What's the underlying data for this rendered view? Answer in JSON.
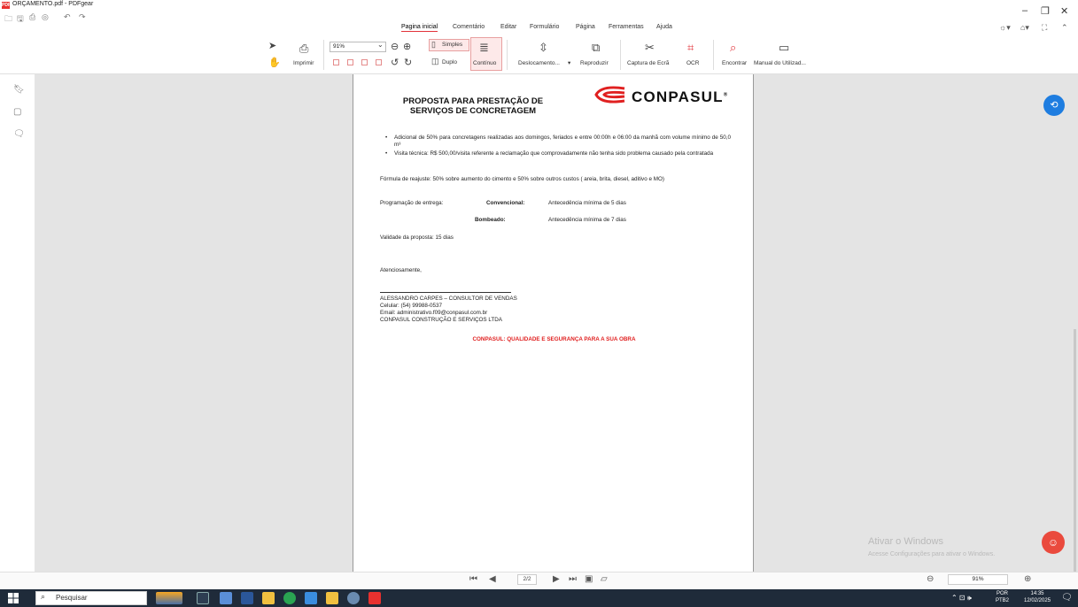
{
  "window": {
    "title": "ORÇAMENTO.pdf - PDFgear",
    "app_badge": "PDF"
  },
  "quick_access": [
    "open-icon",
    "save-icon",
    "print-icon",
    "share-icon",
    "undo-icon",
    "redo-icon"
  ],
  "menu": {
    "items": [
      "Pagina inicial",
      "Comentário",
      "Editar",
      "Formulário",
      "Página",
      "Ferramentas",
      "Ajuda"
    ],
    "active": "Pagina inicial"
  },
  "ribbon": {
    "print_label": "Imprimir",
    "zoom_value": "91%",
    "simple_label": "Simples",
    "double_label": "Duplo",
    "continuous_label": "Contínuo",
    "scroll_label": "Deslocamento...",
    "play_label": "Reproduzir",
    "capture_label": "Captura de Ecrã",
    "ocr_label": "OCR",
    "find_label": "Encontrar",
    "manual_label": "Manual do Utilizad..."
  },
  "document": {
    "title_line1": "PROPOSTA PARA PRESTAÇÃO DE",
    "title_line2": "SERVIÇOS DE CONCRETAGEM",
    "logo_text": "CONPASUL",
    "logo_reg": "®",
    "bullets": [
      "Adicional de 50% para concretagens realizadas aos domingos, feriados e entre 00:00h e 06:00 da manhã com volume mínimo de 50,0 m³",
      "Visita técnica: R$ 500,00/visita referente a reclamação que comprovadamente não tenha sido problema causado pela contratada"
    ],
    "formula": "Fórmula de reajuste: 50% sobre aumento do cimento e 50% sobre outros custos ( areia, brita, diesel, aditivo e MO)",
    "schedule_label": "Programação de entrega:",
    "conv_label": "Convencional:",
    "conv_value": "Antecedência mínima de 5 dias",
    "pump_label": "Bombeado:",
    "pump_value": "Antecedência mínima de 7 dias",
    "validity": "Validade da proposta: 15 dias",
    "closing": "Atenciosamente,",
    "signature": [
      "ALESSANDRO CARPES – CONSULTOR DE VENDAS",
      "Celular: (54) 99988-0537",
      "Email: administrativo.f09@conpasul.com.br",
      "CONPASUL CONSTRUÇÃO E SERVIÇOS LTDA"
    ],
    "slogan": "CONPASUL: QUALIDADE E SEGURANÇA PARA A SUA OBRA"
  },
  "watermark": {
    "line1": "Ativar o Windows",
    "line2": "Acesse Configurações para ativar o Windows."
  },
  "status": {
    "page_indicator": "2/2",
    "zoom": "91%"
  },
  "taskbar": {
    "search_placeholder": "Pesquisar",
    "lang1": "POR",
    "lang2": "PTB2",
    "time": "14:35",
    "date": "12/02/2025"
  },
  "colors": {
    "accent": "#e2333a",
    "logo_red": "#e02020",
    "taskbar": "#1f2b3a",
    "float_blue": "#1e7de0"
  }
}
